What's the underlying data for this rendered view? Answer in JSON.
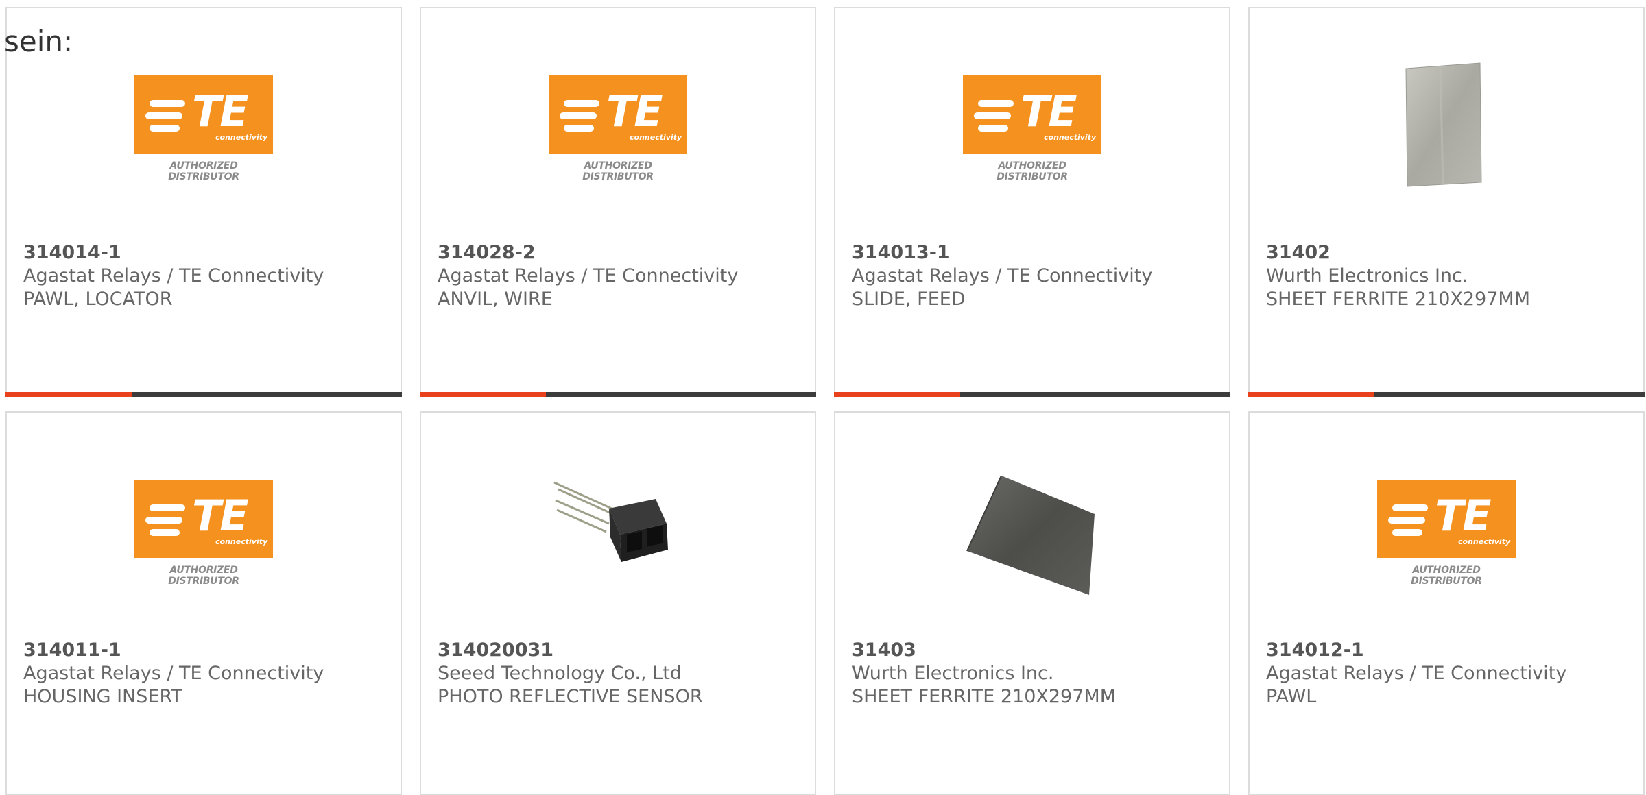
{
  "intro_text": "sein:",
  "colors": {
    "te_orange": "#f5911e",
    "accent_bar": "#e8411c",
    "dark_bar": "#3c3c3c",
    "card_border": "#dcdcdc"
  },
  "te_logo": {
    "mark": "TE",
    "sub": "connectivity",
    "tagline": "AUTHORIZED DISTRIBUTOR"
  },
  "products": [
    {
      "image": "te-logo",
      "part_number": "314014-1",
      "manufacturer": "Agastat Relays / TE Connectivity",
      "description": "PAWL, LOCATOR"
    },
    {
      "image": "te-logo",
      "part_number": "314028-2",
      "manufacturer": "Agastat Relays / TE Connectivity",
      "description": "ANVIL, WIRE"
    },
    {
      "image": "te-logo",
      "part_number": "314013-1",
      "manufacturer": "Agastat Relays / TE Connectivity",
      "description": "SLIDE, FEED"
    },
    {
      "image": "ferrite-sheet-photo",
      "part_number": "31402",
      "manufacturer": "Wurth Electronics Inc.",
      "description": "SHEET FERRITE 210X297MM"
    },
    {
      "image": "te-logo",
      "part_number": "314011-1",
      "manufacturer": "Agastat Relays / TE Connectivity",
      "description": "HOUSING INSERT"
    },
    {
      "image": "sensor-photo",
      "part_number": "314020031",
      "manufacturer": "Seeed Technology Co., Ltd",
      "description": "PHOTO REFLECTIVE SENSOR"
    },
    {
      "image": "ferrite-sheet-dark-photo",
      "part_number": "31403",
      "manufacturer": "Wurth Electronics Inc.",
      "description": "SHEET FERRITE 210X297MM"
    },
    {
      "image": "te-logo",
      "part_number": "314012-1",
      "manufacturer": "Agastat Relays / TE Connectivity",
      "description": "PAWL"
    }
  ]
}
